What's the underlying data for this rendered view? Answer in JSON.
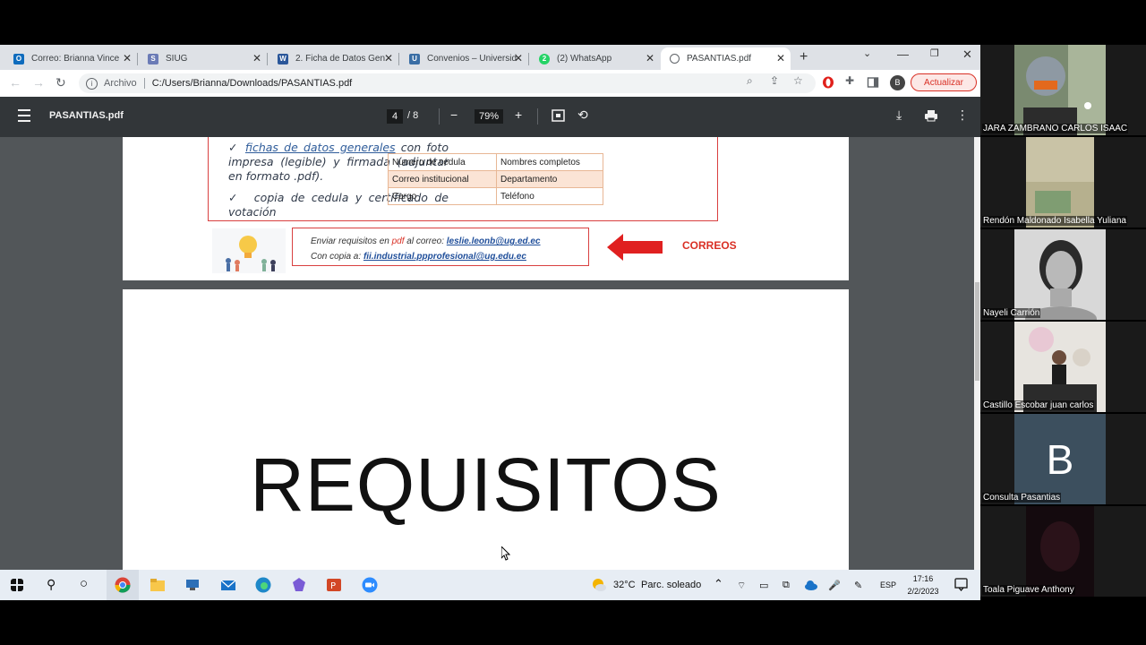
{
  "browser": {
    "tabs": [
      {
        "label": "Correo: Brianna Vince",
        "icon": "outlook-icon",
        "color": "#0f6cbd"
      },
      {
        "label": "SIUG",
        "icon": "siug-icon",
        "color": "#6b7bb6"
      },
      {
        "label": "2. Ficha de Datos Gen",
        "icon": "word-icon",
        "color": "#2b579a"
      },
      {
        "label": "Convenios – Universid",
        "icon": "university-icon",
        "color": "#3a6ea5"
      },
      {
        "label": "(2) WhatsApp",
        "icon": "whatsapp-icon",
        "color": "#25d366"
      },
      {
        "label": "PASANTIAS.pdf",
        "icon": "globe-icon",
        "color": "#5f6368"
      }
    ],
    "address": {
      "scheme": "Archivo",
      "url": "C:/Users/Brianna/Downloads/PASANTIAS.pdf"
    },
    "profile_initial": "B",
    "update_label": "Actualizar"
  },
  "pdf": {
    "title": "PASANTIAS.pdf",
    "current_page": "4",
    "page_total": "/ 8",
    "zoom": "79%",
    "page1": {
      "bullet1_underlined": "fichas de datos generales",
      "bullet1_rest": " con foto impresa (legible) y firmada (adjuntar en formato .pdf).",
      "bullet2": "copia de cedula y certificado de votación",
      "check": "✓",
      "table": [
        [
          "Numero de cédula",
          "Nombres completos"
        ],
        [
          "Correo institucional",
          "Departamento"
        ],
        [
          "Cargo",
          "Teléfono"
        ]
      ],
      "send_prefix": "Enviar requisitos en ",
      "send_pdf": "pdf",
      "send_mid": " al correo: ",
      "send_email": "leslie.leonb@ug.ed.ec",
      "copy_prefix": "Con copia a:  ",
      "copy_email": "fii.industrial.ppprofesional@ug.edu.ec",
      "callout": "CORREOS"
    },
    "page2": {
      "heading": "REQUISITOS"
    }
  },
  "taskbar": {
    "weather_temp": "32°C",
    "weather_desc": "Parc. soleado",
    "lang": "ESP",
    "time": "17:16",
    "date": "2/2/2023"
  },
  "participants": [
    {
      "name": "JARA ZAMBRANO CARLOS ISAAC",
      "kind": "video"
    },
    {
      "name": "Rendón Maldonado Isabella Yuliana",
      "kind": "video"
    },
    {
      "name": "Nayeli Carrión",
      "kind": "video"
    },
    {
      "name": "Castillo Escobar juan carlos",
      "kind": "video"
    },
    {
      "name": "Consulta Pasantias",
      "kind": "initial",
      "initial": "B",
      "color": "#3c4f5e"
    },
    {
      "name": "Toala Piguave Anthony",
      "kind": "video"
    }
  ]
}
